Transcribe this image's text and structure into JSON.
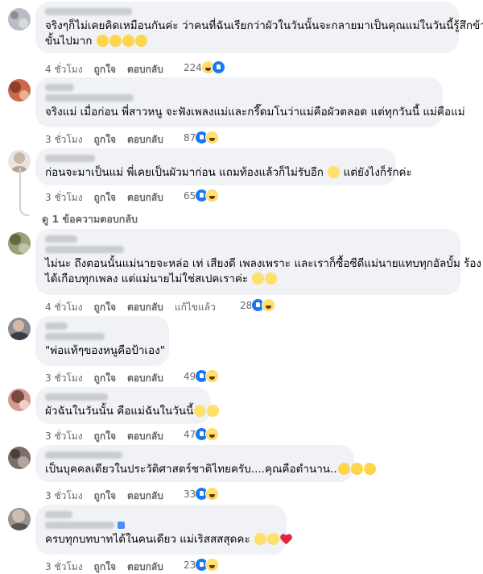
{
  "labels": {
    "like": "ถูกใจ",
    "reply": "ตอบกลับ",
    "edited": "แก้ไขแล้ว"
  },
  "comments": [
    {
      "time": "4 ชั่วโมง",
      "lines": [
        "จริงๆก็ไม่เคยคิดเหมือนกันค่ะ ว่าคนที่ฉันเรียกว่าผัวในวันนั้นจะกลายมาเป็นคุณแม่ในวันนี้รู้สึกข้าม",
        "ขั้นไปมาก"
      ],
      "emoji": [
        "rofl",
        "rofl",
        "rofl",
        "rofl"
      ],
      "reaction_count": "224",
      "reactions": [
        "haha",
        "like"
      ]
    },
    {
      "time": "3 ชั่วโมง",
      "lines": [
        "จริงแม่ เมื่อก่อน พี่สาวหนู จะฟังเพลงแม่และกรี๊ดมโนว่าแม่คือผัวตลอด แต่ทุกวันนี้ แม่คือแม่"
      ],
      "emoji": [],
      "reaction_count": "87",
      "reactions": [
        "like",
        "haha"
      ]
    },
    {
      "time": "3 ชั่วโมง",
      "lines": [
        "ก่อนจะมาเป็นแม่ พี่เคยเป็นผัวมาก่อน แถมท้องแล้วก็ไม่รับอีก",
        "แต่ยังไงก็รักค่ะ"
      ],
      "emoji": [
        "grin"
      ],
      "reaction_count": "65",
      "reactions": [
        "like",
        "haha"
      ]
    },
    {
      "time": "4 ชั่วโมง",
      "lines": [
        "ไม่นะ ถึงตอนนั้นแม่นายจะหล่อ เท่ เสียงดี เพลงเพราะ และเราก็ซื้อซีดีแม่นายแทบทุกอัลบั้ม ร้อง",
        "ได้เกือบทุกเพลง แต่แม่นายไม่ใช่สเปคเราค่ะ"
      ],
      "emoji": [
        "grin",
        "grin"
      ],
      "reaction_count": "28",
      "reactions": [
        "like",
        "haha"
      ],
      "edited": true
    },
    {
      "time": "3 ชั่วโมง",
      "lines": [
        "\"พ่อแท้ๆของหนูคือป้าเอง\""
      ],
      "emoji": [],
      "reaction_count": "49",
      "reactions": [
        "like",
        "haha"
      ]
    },
    {
      "time": "3 ชั่วโมง",
      "lines": [
        "ผัวฉันในวันนั้น คือแม่ฉันในวันนี้"
      ],
      "emoji": [
        "grin",
        "grin"
      ],
      "reaction_count": "47",
      "reactions": [
        "like",
        "haha"
      ]
    },
    {
      "time": "3 ชั่วโมง",
      "lines": [
        "เป็นบุคคลเดียวในประวัติศาสตร์ชาติไทยครับ....คุณคือตำนาน.."
      ],
      "emoji": [
        "rofl",
        "rofl",
        "rofl"
      ],
      "reaction_count": "33",
      "reactions": [
        "like",
        "haha"
      ]
    },
    {
      "time": "3 ชั่วโมง",
      "lines": [
        "ครบทุกบทบาทได้ในคนเดียว แม่เริสสสสุดคะ"
      ],
      "emoji": [
        "grin",
        "grin",
        "heart"
      ],
      "reaction_count": "23",
      "reactions": [
        "like",
        "haha"
      ]
    }
  ],
  "view_replies": "ดู 1 ข้อความตอบกลับ"
}
